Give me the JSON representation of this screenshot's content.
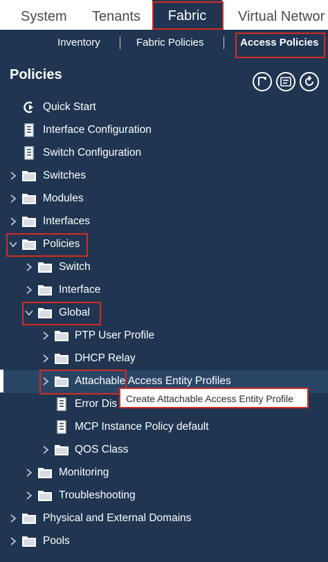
{
  "top_tabs": {
    "system": "System",
    "tenants": "Tenants",
    "fabric": "Fabric",
    "virtual_networking": "Virtual Networ"
  },
  "sub_nav": {
    "inventory": "Inventory",
    "fabric_policies": "Fabric Policies",
    "access_policies": "Access Policies"
  },
  "panel": {
    "title": "Policies",
    "header_icons": [
      "tag-icon",
      "list-icon",
      "refresh-icon"
    ]
  },
  "tree": {
    "quick_start": "Quick Start",
    "interface_configuration": "Interface Configuration",
    "switch_configuration": "Switch Configuration",
    "switches": "Switches",
    "modules": "Modules",
    "interfaces": "Interfaces",
    "policies": "Policies",
    "switch": "Switch",
    "interface": "Interface",
    "global": "Global",
    "ptp_user_profile": "PTP User Profile",
    "dhcp_relay": "DHCP Relay",
    "aaep": "Attachable Access Entity Profiles",
    "error_dis": "Error Dis",
    "mcp_default": "MCP Instance Policy default",
    "qos_class": "QOS Class",
    "monitoring": "Monitoring",
    "troubleshooting": "Troubleshooting",
    "physical_external_domains": "Physical and External Domains",
    "pools": "Pools"
  },
  "tooltip": {
    "text": "Create Attachable Access Entity Profile"
  },
  "colors": {
    "background": "#1f3551",
    "highlight": "#d62b1f",
    "selected_row": "#2a4667",
    "text": "#ffffff"
  }
}
